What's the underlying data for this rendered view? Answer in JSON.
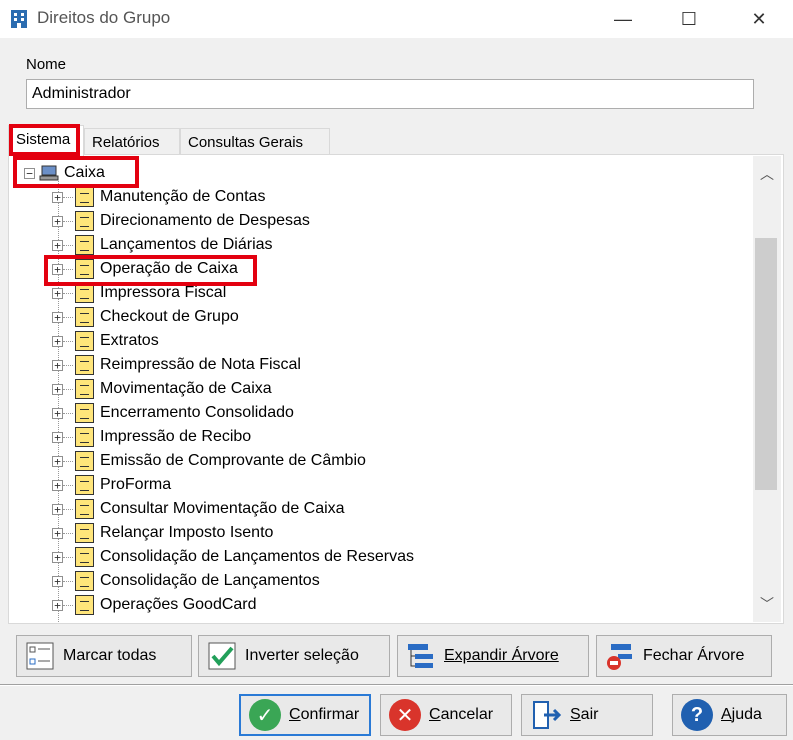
{
  "window": {
    "title": "Direitos do Grupo",
    "minimize_glyph": "—",
    "maximize_glyph": "☐",
    "close_glyph": "✕"
  },
  "form": {
    "nome_label": "Nome",
    "nome_value": "Administrador"
  },
  "tabs": [
    {
      "label": "Sistema",
      "active": true
    },
    {
      "label": "Relatórios",
      "active": false
    },
    {
      "label": "Consultas Gerais",
      "active": false
    }
  ],
  "tree": {
    "root": {
      "label": "Caixa",
      "icon": "computer-icon",
      "expanded": true
    },
    "children": [
      "Manutenção de Contas",
      "Direcionamento de Despesas",
      "Lançamentos de Diárias",
      "Operação de Caixa",
      "Impressora Fiscal",
      "Checkout de Grupo",
      "Extratos",
      "Reimpressão de Nota Fiscal",
      "Movimentação de Caixa",
      "Encerramento Consolidado",
      "Impressão de Recibo",
      "Emissão de Comprovante de Câmbio",
      "ProForma",
      "Consultar Movimentação de Caixa",
      "Relançar Imposto Isento",
      "Consolidação de Lançamentos de Reservas",
      "Consolidação de Lançamentos",
      "Operações GoodCard"
    ]
  },
  "tree_buttons": {
    "marcar_todas": "Marcar todas",
    "inverter_selecao": "Inverter seleção",
    "expandir_arvore": "Expandir Árvore",
    "fechar_arvore": "Fechar Árvore"
  },
  "buttons": {
    "confirmar": {
      "first": "C",
      "rest": "onfirmar"
    },
    "cancelar": {
      "first": "C",
      "rest": "ancelar"
    },
    "sair": {
      "first": "S",
      "rest": "air"
    },
    "ajuda": {
      "first": "A",
      "rest": "juda"
    }
  },
  "colors": {
    "highlight": "#e3000f",
    "confirm_green": "#3aa655",
    "cancel_red": "#d9342b",
    "help_blue": "#2060b0"
  }
}
